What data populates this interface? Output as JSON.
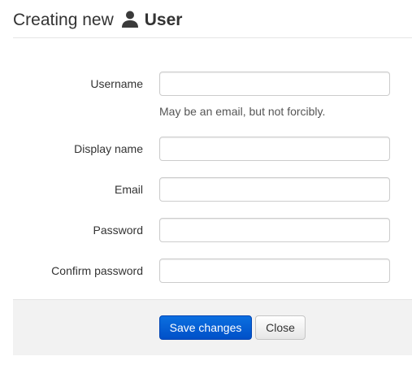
{
  "header": {
    "title_prefix": "Creating new",
    "title_entity": "User",
    "icon": "user-icon"
  },
  "form": {
    "fields": [
      {
        "label": "Username",
        "value": "",
        "help": "May be an email, but not forcibly."
      },
      {
        "label": "Display name",
        "value": ""
      },
      {
        "label": "Email",
        "value": ""
      },
      {
        "label": "Password",
        "value": ""
      },
      {
        "label": "Confirm password",
        "value": ""
      }
    ]
  },
  "actions": {
    "save_label": "Save changes",
    "close_label": "Close"
  },
  "colors": {
    "primary_button": "#0b6fe0",
    "actions_background": "#f2f2f2"
  }
}
